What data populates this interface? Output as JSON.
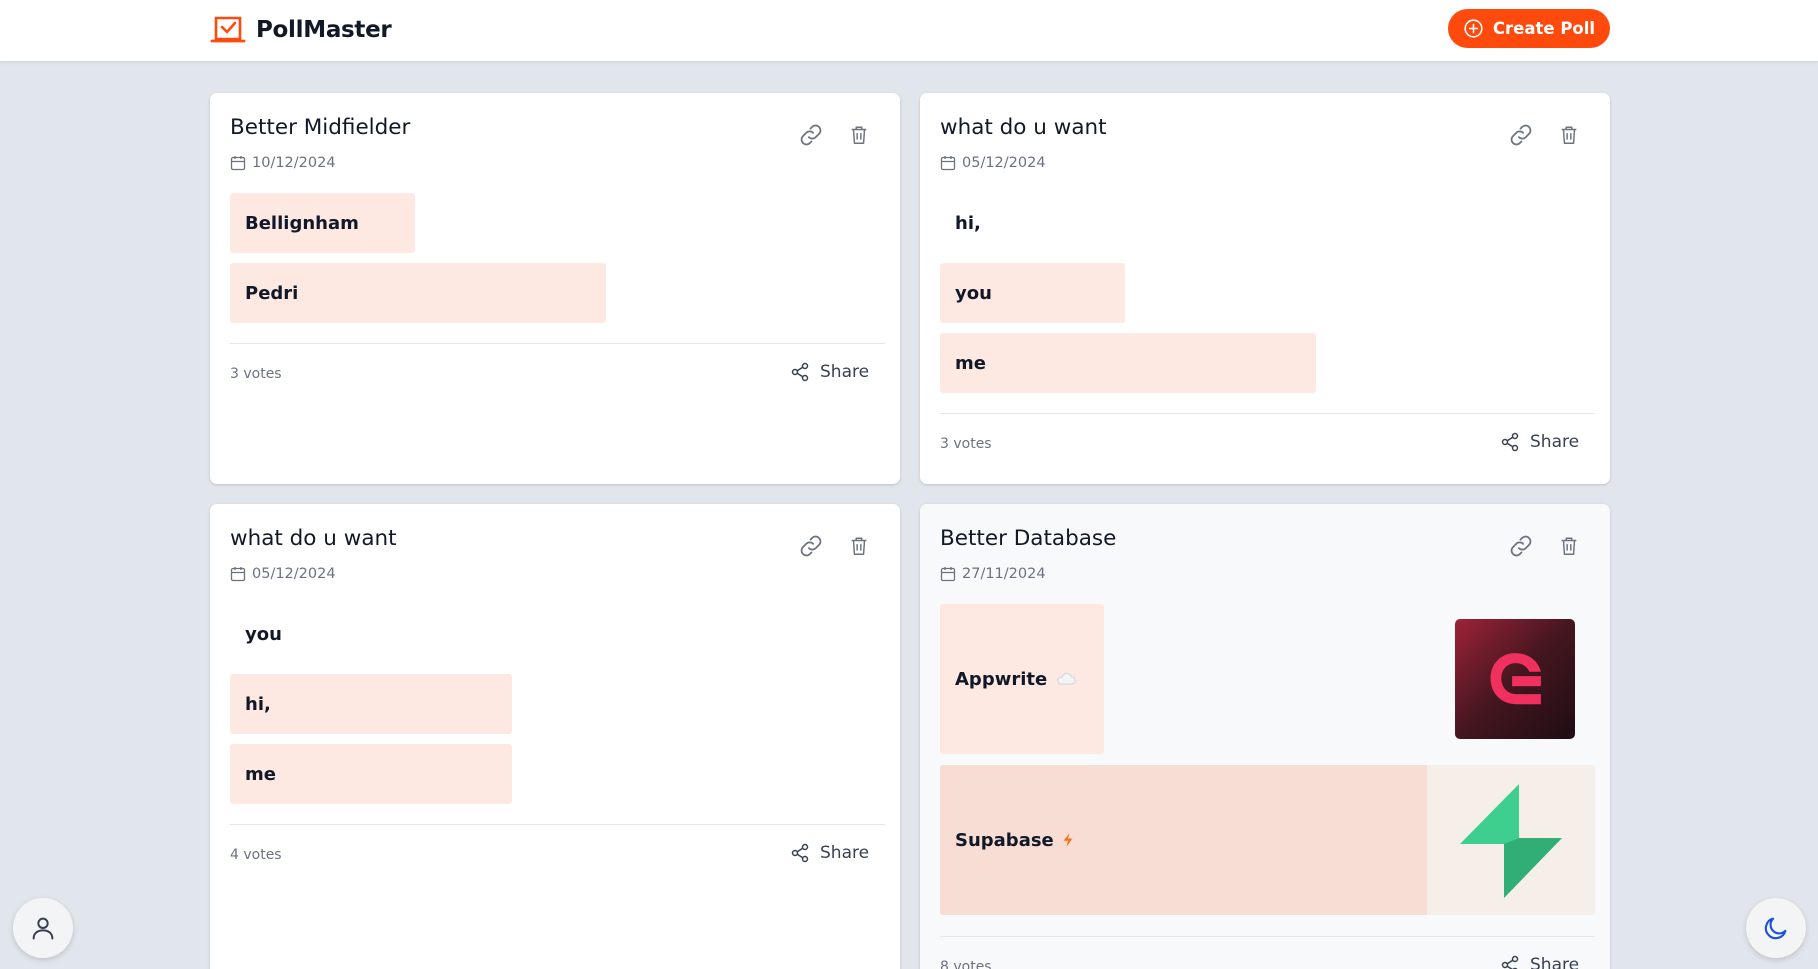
{
  "app": {
    "name": "PollMaster",
    "create_label": "Create Poll"
  },
  "colors": {
    "brand": "#ff4a0d",
    "option_fill": "#fde9e1",
    "page_bg": "#e1e5ec"
  },
  "icons": {
    "brand": "ballot-box-icon",
    "create": "plus-circle-icon",
    "date": "calendar-icon",
    "link": "link-icon",
    "delete": "trash-icon",
    "share": "share-icon",
    "profile": "user-icon",
    "theme": "moon-icon"
  },
  "share_label": "Share",
  "polls": [
    {
      "title": "Better Midfielder",
      "date": "10/12/2024",
      "votes": "3 votes",
      "options": [
        {
          "label": "Bellignham",
          "share": 0.283
        },
        {
          "label": "Pedri",
          "share": 0.574
        }
      ]
    },
    {
      "title": "what do u want",
      "date": "05/12/2024",
      "votes": "3 votes",
      "options": [
        {
          "label": "hi,",
          "share": 0.0
        },
        {
          "label": "you",
          "share": 0.283
        },
        {
          "label": "me",
          "share": 0.574
        }
      ]
    },
    {
      "title": "what do u want",
      "date": "05/12/2024",
      "votes": "4 votes",
      "options": [
        {
          "label": "you",
          "share": 0.0
        },
        {
          "label": "hi,",
          "share": 0.43
        },
        {
          "label": "me",
          "share": 0.43
        }
      ]
    },
    {
      "title": "Better Database",
      "date": "27/11/2024",
      "votes": "8 votes",
      "options": [
        {
          "label": "Appwrite",
          "icon": "cloud-icon",
          "share": 0.25
        },
        {
          "label": "Supabase",
          "icon": "bolt-icon",
          "share": 0.75
        }
      ]
    }
  ]
}
